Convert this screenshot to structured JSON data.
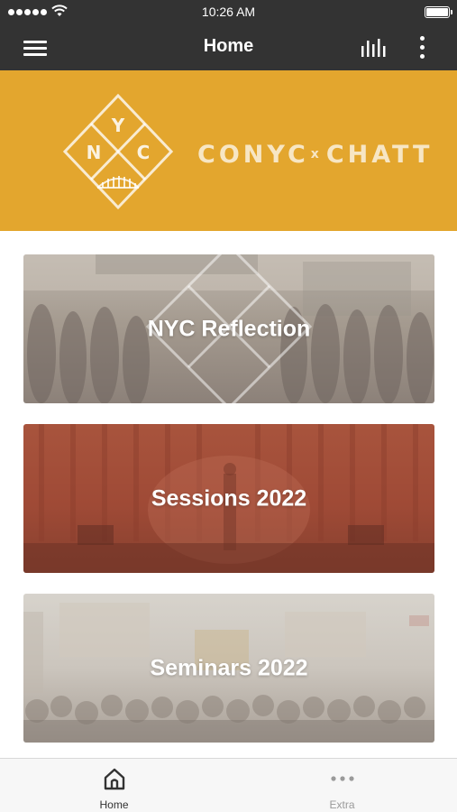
{
  "status_bar": {
    "time": "10:26 AM"
  },
  "app_bar": {
    "title": "Home"
  },
  "banner": {
    "logo_letters": [
      "Y",
      "N",
      "C"
    ],
    "wordmark": {
      "left": "CONYC",
      "separator": "x",
      "right": "CHATT"
    }
  },
  "cards": [
    {
      "title": "NYC Reflection"
    },
    {
      "title": "Sessions 2022"
    },
    {
      "title": "Seminars 2022"
    }
  ],
  "tab_bar": {
    "tabs": [
      {
        "label": "Home",
        "icon": "home-icon",
        "selected": true
      },
      {
        "label": "Extra",
        "icon": "more-horizontal-icon",
        "selected": false
      }
    ]
  },
  "colors": {
    "bar": "#333333",
    "banner": "#E3A62E",
    "tab_active": "#333333",
    "tab_inactive": "#9A9A9A"
  }
}
